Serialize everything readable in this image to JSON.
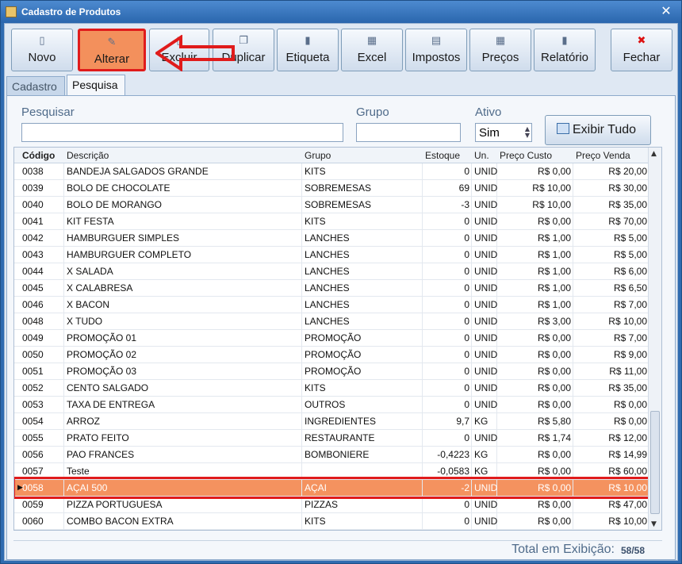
{
  "window": {
    "title": "Cadastro de Produtos",
    "close_glyph": "✕"
  },
  "toolbar": {
    "buttons": [
      {
        "label": "Novo",
        "icon": "new-document-icon",
        "glyph": "▯"
      },
      {
        "label": "Alterar",
        "icon": "edit-pencil-icon",
        "glyph": "✎"
      },
      {
        "label": "Excluir",
        "icon": "delete-document-icon",
        "glyph": "▯"
      },
      {
        "label": "Duplicar",
        "icon": "duplicate-icon",
        "glyph": "❐"
      },
      {
        "label": "Etiqueta",
        "icon": "label-icon",
        "glyph": "▮"
      },
      {
        "label": "Excel",
        "icon": "excel-icon",
        "glyph": "▦"
      },
      {
        "label": "Impostos",
        "icon": "taxes-icon",
        "glyph": "▤"
      },
      {
        "label": "Preços",
        "icon": "prices-icon",
        "glyph": "▦"
      },
      {
        "label": "Relatório",
        "icon": "report-icon",
        "glyph": "▮"
      },
      {
        "label": "Fechar",
        "icon": "close-x-icon",
        "glyph": "✖"
      }
    ],
    "highlight_color": "#e01b1b",
    "active_color": "#f3905c"
  },
  "tabs": [
    {
      "label": "Cadastro"
    },
    {
      "label": "Pesquisa"
    }
  ],
  "filters": {
    "search_label": "Pesquisar",
    "search_value": "",
    "group_label": "Grupo",
    "group_value": "",
    "active_label": "Ativo",
    "active_value": "Sim",
    "show_all_label": "Exibir Tudo"
  },
  "grid": {
    "columns": [
      "Código",
      "Descrição",
      "Grupo",
      "Estoque",
      "Un.",
      "Preço Custo",
      "Preço Venda"
    ],
    "rows": [
      [
        "0038",
        "BANDEJA SALGADOS GRANDE",
        "KITS",
        "0",
        "UNID",
        "R$ 0,00",
        "R$ 20,00"
      ],
      [
        "0039",
        "BOLO DE CHOCOLATE",
        "SOBREMESAS",
        "69",
        "UNID",
        "R$ 10,00",
        "R$ 30,00"
      ],
      [
        "0040",
        "BOLO DE MORANGO",
        "SOBREMESAS",
        "-3",
        "UNID",
        "R$ 10,00",
        "R$ 35,00"
      ],
      [
        "0041",
        "KIT FESTA",
        "KITS",
        "0",
        "UNID",
        "R$ 0,00",
        "R$ 70,00"
      ],
      [
        "0042",
        "HAMBURGUER SIMPLES",
        "LANCHES",
        "0",
        "UNID",
        "R$ 1,00",
        "R$ 5,00"
      ],
      [
        "0043",
        "HAMBURGUER COMPLETO",
        "LANCHES",
        "0",
        "UNID",
        "R$ 1,00",
        "R$ 5,00"
      ],
      [
        "0044",
        "X SALADA",
        "LANCHES",
        "0",
        "UNID",
        "R$ 1,00",
        "R$ 6,00"
      ],
      [
        "0045",
        "X CALABRESA",
        "LANCHES",
        "0",
        "UNID",
        "R$ 1,00",
        "R$ 6,50"
      ],
      [
        "0046",
        "X BACON",
        "LANCHES",
        "0",
        "UNID",
        "R$ 1,00",
        "R$ 7,00"
      ],
      [
        "0048",
        "X TUDO",
        "LANCHES",
        "0",
        "UNID",
        "R$ 3,00",
        "R$ 10,00"
      ],
      [
        "0049",
        "PROMOÇÃO 01",
        "PROMOÇÃO",
        "0",
        "UNID",
        "R$ 0,00",
        "R$ 7,00"
      ],
      [
        "0050",
        "PROMOÇÃO 02",
        "PROMOÇÃO",
        "0",
        "UNID",
        "R$ 0,00",
        "R$ 9,00"
      ],
      [
        "0051",
        "PROMOÇÃO 03",
        "PROMOÇÃO",
        "0",
        "UNID",
        "R$ 0,00",
        "R$ 11,00"
      ],
      [
        "0052",
        "CENTO SALGADO",
        "KITS",
        "0",
        "UNID",
        "R$ 0,00",
        "R$ 35,00"
      ],
      [
        "0053",
        "TAXA DE ENTREGA",
        "OUTROS",
        "0",
        "UNID",
        "R$ 0,00",
        "R$ 0,00"
      ],
      [
        "0054",
        "ARROZ",
        "INGREDIENTES",
        "9,7",
        "KG",
        "R$ 5,80",
        "R$ 0,00"
      ],
      [
        "0055",
        "PRATO FEITO",
        "RESTAURANTE",
        "0",
        "UNID",
        "R$ 1,74",
        "R$ 12,00"
      ],
      [
        "0056",
        "PAO FRANCES",
        "BOMBONIERE",
        "-0,4223",
        "KG",
        "R$ 0,00",
        "R$ 14,99"
      ],
      [
        "0057",
        "Teste",
        "",
        "-0,0583",
        "KG",
        "R$ 0,00",
        "R$ 60,00"
      ],
      [
        "0058",
        "AÇAI 500",
        "AÇAI",
        "-2",
        "UNID",
        "R$ 0,00",
        "R$ 10,00"
      ],
      [
        "0059",
        "PIZZA PORTUGUESA",
        "PIZZAS",
        "0",
        "UNID",
        "R$ 0,00",
        "R$ 47,00"
      ],
      [
        "0060",
        "COMBO BACON EXTRA",
        "KITS",
        "0",
        "UNID",
        "R$ 0,00",
        "R$ 10,00"
      ]
    ],
    "selected_index": 19,
    "selected_color": "#f4925f"
  },
  "footer": {
    "total_label": "Total em Exibição:",
    "count": "58/58"
  }
}
